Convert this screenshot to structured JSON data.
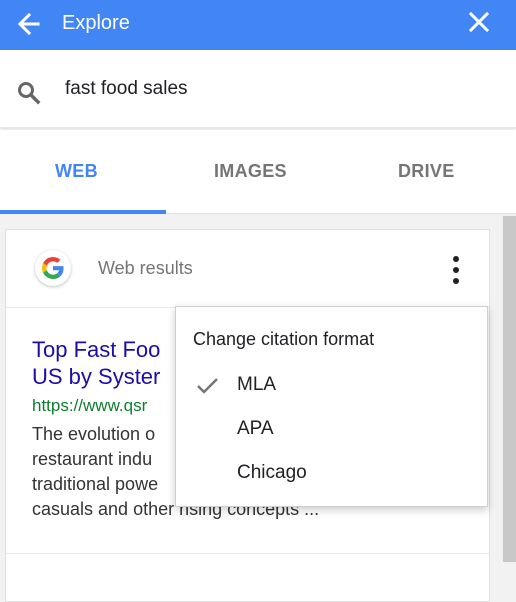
{
  "header": {
    "title": "Explore",
    "back_icon": "arrow-back-icon",
    "close_icon": "close-icon",
    "color": "#4285f4"
  },
  "search": {
    "icon": "search-icon",
    "query": "fast food sales"
  },
  "tabs": [
    {
      "label": "WEB",
      "active": true
    },
    {
      "label": "IMAGES",
      "active": false
    },
    {
      "label": "DRIVE",
      "active": false
    }
  ],
  "card": {
    "logo": "google-g-icon",
    "label": "Web results",
    "menu_icon": "more-vert-icon"
  },
  "result": {
    "title_line1": "Top Fast Foo",
    "title_line2": "US by Syster",
    "url": "https://www.qsr",
    "snippet_line1": "The evolution o",
    "snippet_line2": "restaurant indu",
    "snippet_line3": "traditional powe",
    "snippet_line4": "casuals and other rising concepts ..."
  },
  "citation_menu": {
    "title": "Change citation format",
    "check_icon": "checkmark-icon",
    "options": [
      "MLA",
      "APA",
      "Chicago"
    ],
    "selected": "MLA"
  }
}
